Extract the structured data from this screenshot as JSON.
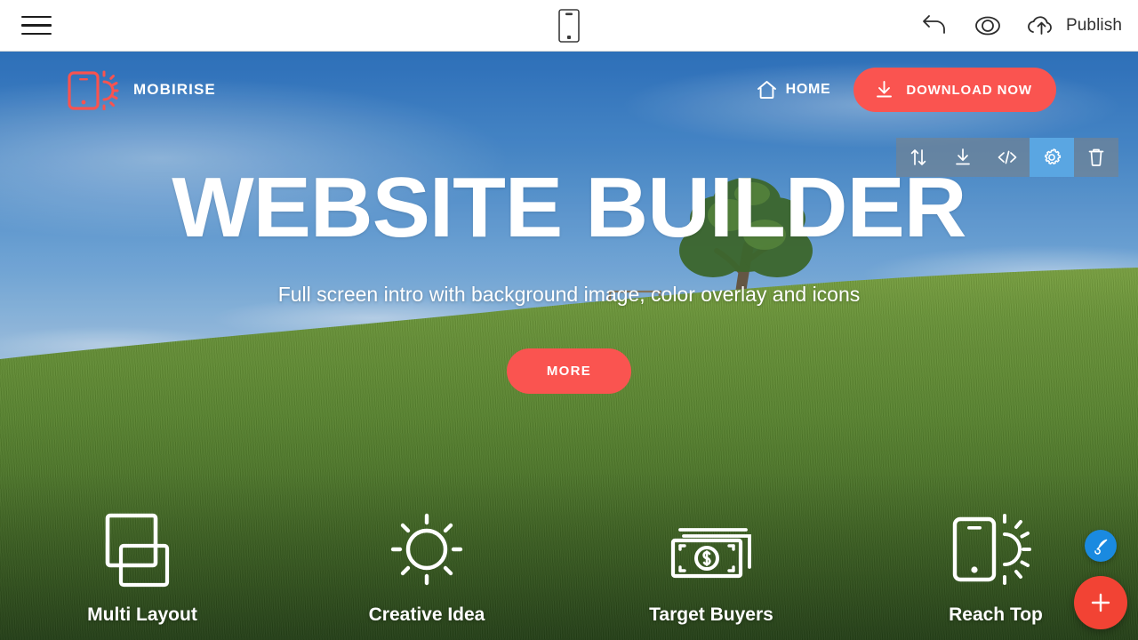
{
  "editor": {
    "menu_icon": "hamburger-icon",
    "device_icon": "mobile-device-icon",
    "undo_icon": "undo-arrow-icon",
    "preview_icon": "eye-icon",
    "publish_icon": "cloud-upload-icon",
    "publish_label": "Publish"
  },
  "block_toolbar": {
    "tools": [
      {
        "name": "move-block",
        "icon": "up-down-arrows-icon",
        "active": false
      },
      {
        "name": "download-block",
        "icon": "download-icon",
        "active": false
      },
      {
        "name": "edit-code",
        "icon": "code-brackets-icon",
        "active": false
      },
      {
        "name": "block-settings",
        "icon": "gear-icon",
        "active": true
      },
      {
        "name": "delete-block",
        "icon": "trash-icon",
        "active": false
      }
    ],
    "active_color": "#5aa6e2",
    "background_color": "#78828c"
  },
  "site": {
    "brand": {
      "name": "MOBIRISE",
      "logo_icon": "mobirise-phone-sun-icon",
      "logo_color": "#f9534f"
    },
    "nav": {
      "home_label": "HOME",
      "home_icon": "home-icon",
      "download_label": "DOWNLOAD NOW",
      "download_icon": "download-arrow-icon",
      "download_color": "#fa5450"
    },
    "hero": {
      "title": "WEBSITE BUILDER",
      "subtitle": "Full screen intro with background image, color overlay and icons",
      "cta_label": "MORE",
      "cta_color": "#fa5450"
    },
    "features": [
      {
        "label": "Multi Layout",
        "icon": "stacked-squares-icon"
      },
      {
        "label": "Creative Idea",
        "icon": "sun-icon"
      },
      {
        "label": "Target Buyers",
        "icon": "money-stack-dollar-icon"
      },
      {
        "label": "Reach Top",
        "icon": "phone-sun-icon"
      }
    ]
  },
  "fabs": {
    "style_icon": "paint-brush-icon",
    "style_color": "#1a8ae0",
    "add_icon": "plus-icon",
    "add_color": "#f24334"
  }
}
